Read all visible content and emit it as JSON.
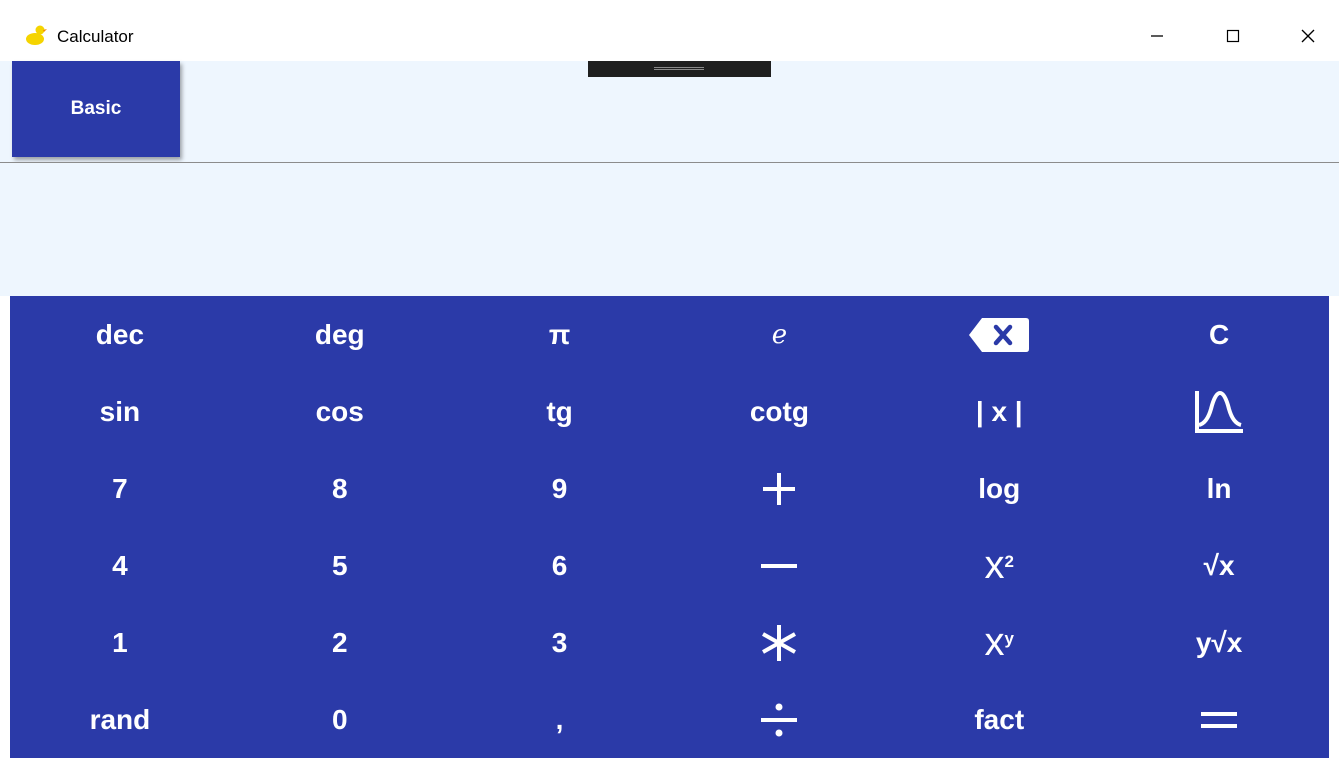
{
  "window": {
    "title": "Calculator",
    "app_icon": "calculator-duck-icon",
    "accent": "#2b3aa8",
    "background": "#eef6fe"
  },
  "mode": {
    "active_label": "Basic"
  },
  "display": {
    "value": ""
  },
  "keys": {
    "dec": "dec",
    "deg": "deg",
    "pi": "π",
    "e": "e",
    "backspace": "backspace-icon",
    "clear": "C",
    "sin": "sin",
    "cos": "cos",
    "tg": "tg",
    "cotg": "cotg",
    "abs": "| x |",
    "graph": "graph-icon",
    "n7": "7",
    "n8": "8",
    "n9": "9",
    "plus": "+",
    "log": "log",
    "ln": "ln",
    "n4": "4",
    "n5": "5",
    "n6": "6",
    "minus": "−",
    "square_base": "x",
    "square_exp": "2",
    "sqrt": "√x",
    "n1": "1",
    "n2": "2",
    "n3": "3",
    "multiply": "✱",
    "power_base": "x",
    "power_exp": "y",
    "yroot": "y√x",
    "rand": "rand",
    "n0": "0",
    "comma": ",",
    "divide": "÷",
    "fact": "fact",
    "equals": "="
  }
}
